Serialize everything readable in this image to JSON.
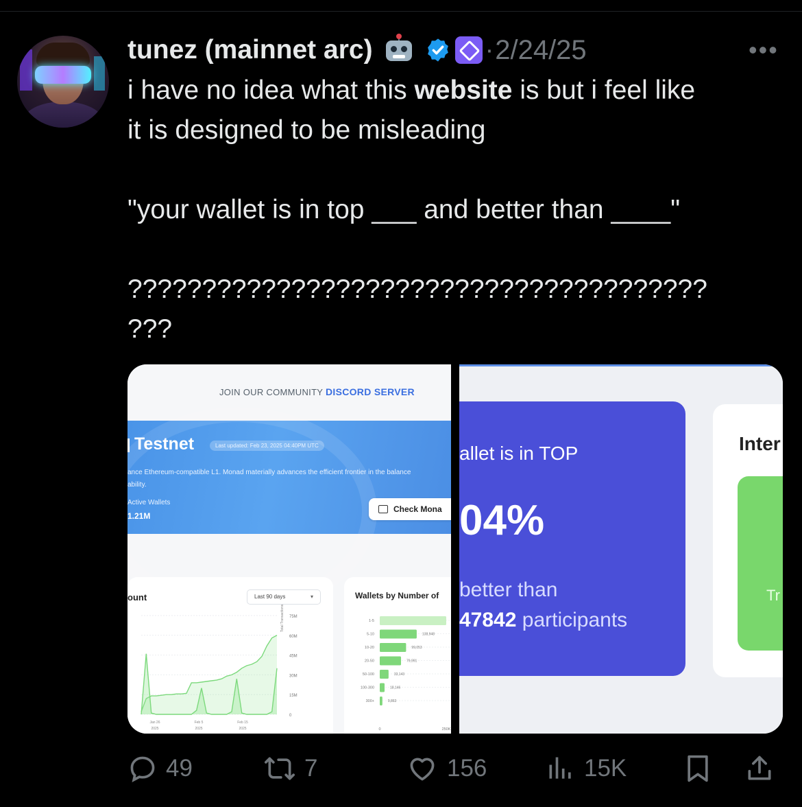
{
  "tweet": {
    "display_name": "tunez (mainnet arc)",
    "date": "2/24/25",
    "separator": "·",
    "more": "•••",
    "text_line1_pre": "i have no idea what this ",
    "text_line1_bold": "website",
    "text_line1_post": " is but i feel like",
    "text_line2": "it is designed to be misleading",
    "text_line3": "\"your wallet is in top ___ and better than ____\"",
    "text_line4": "???????????????????????????????????????",
    "text_line5": "???"
  },
  "media": {
    "left": {
      "join_prefix": "JOIN OUR COMMUNITY",
      "join_link": "DISCORD SERVER",
      "testnet_title": "Testnet",
      "last_updated": "Last updated: Feb 23, 2025 04:40PM UTC",
      "desc_line1": "ance Ethereum-compatible L1. Monad materially advances the efficient frontier in the balance",
      "desc_line2": "ability.",
      "active_wallets_label": "Active Wallets",
      "active_wallets_value": "1.21M",
      "check_button": "Check Mona",
      "chart1_title": "ount",
      "chart1_dropdown": "Last 90 days",
      "chart1_yaxis_label": "Total Transactions",
      "chart1_yticks": [
        "75M",
        "60M",
        "45M",
        "30M",
        "15M",
        "0"
      ],
      "chart1_xticks": [
        [
          "Jan 26",
          "2025"
        ],
        [
          "Feb 5",
          "2025"
        ],
        [
          "Feb 15",
          "2025"
        ]
      ],
      "chart2_title": "Wallets by Number of",
      "chart2_xticks": [
        "0",
        "250K",
        "50"
      ]
    },
    "right": {
      "top_text": "allet is in TOP",
      "percent": "04%",
      "better_than": "better than",
      "participants_number": "47842",
      "participants_label": " participants",
      "inter_title": "Inter",
      "tr_text": "Tr"
    }
  },
  "chart_data": [
    {
      "type": "area",
      "title": "ount",
      "ylabel": "Total Transactions",
      "x": [
        "Jan 26 2025",
        "Feb 5 2025",
        "Feb 15 2025"
      ],
      "yticks": [
        "75M",
        "60M",
        "45M",
        "30M",
        "15M",
        "0"
      ],
      "ylim": [
        0,
        75000000
      ],
      "series": [
        {
          "values": [
            2000000,
            12000000,
            14000000,
            14000000,
            14500000,
            15000000,
            15000000,
            15500000,
            15500000,
            16000000,
            24000000,
            24000000,
            24500000,
            25000000,
            25500000,
            26000000,
            27000000,
            29000000,
            30000000,
            32000000,
            35000000,
            37000000,
            38000000,
            40000000,
            44000000,
            52000000,
            58000000,
            60000000
          ]
        },
        {
          "values": [
            0,
            46000000,
            1000000,
            0,
            0,
            0,
            0,
            0,
            0,
            0,
            0,
            3000000,
            20000000,
            1000000,
            0,
            0,
            0,
            0,
            2000000,
            27000000,
            1000000,
            0,
            0,
            0,
            0,
            0,
            2000000,
            35000000
          ]
        }
      ]
    },
    {
      "type": "bar",
      "title": "Wallets by Number of",
      "categories": [
        "1-5",
        "5-10",
        "10-20",
        "20-50",
        "50-100",
        "100-300",
        "300+"
      ],
      "values": [
        250000,
        138948,
        99053,
        79991,
        33143,
        18146,
        9863
      ],
      "data_labels": [
        "",
        "138,948",
        "99,053",
        "79,991",
        "33,143",
        "18,146",
        "9,863"
      ],
      "xticks": [
        "0",
        "250K",
        "50"
      ],
      "xlim": [
        0,
        500000
      ]
    }
  ],
  "actions": {
    "replies": "49",
    "reposts": "7",
    "likes": "156",
    "views": "15K"
  },
  "colors": {
    "background": "#000000",
    "text": "#e7e9ea",
    "muted": "#71767b",
    "verified": "#1d9bf0",
    "org_badge": "#7b5cf5"
  }
}
